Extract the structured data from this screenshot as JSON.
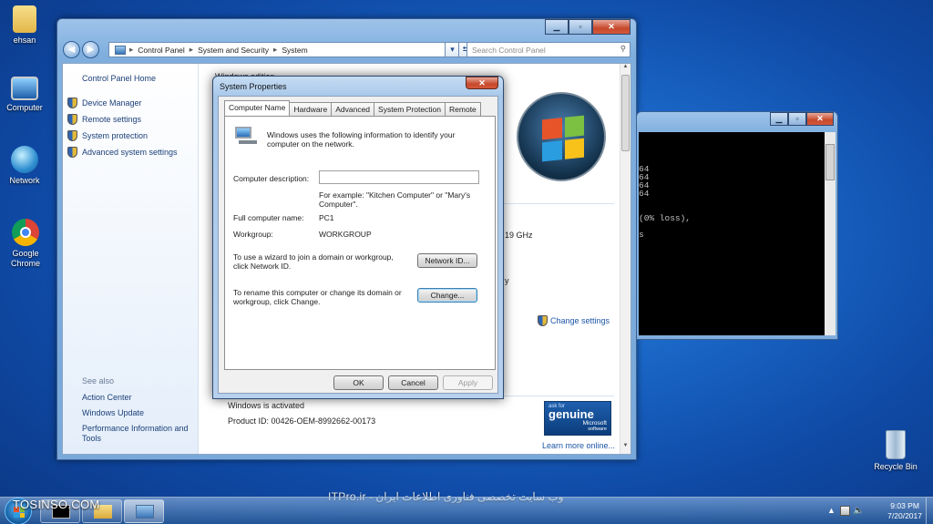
{
  "desktop": {
    "icons": [
      {
        "label": "ehsan"
      },
      {
        "label": "Computer"
      },
      {
        "label": "Network"
      },
      {
        "label": "Google Chrome"
      },
      {
        "label": "Recycle Bin"
      }
    ]
  },
  "control_panel": {
    "breadcrumb": [
      "Control Panel",
      "System and Security",
      "System"
    ],
    "search_placeholder": "Search Control Panel",
    "left": {
      "home": "Control Panel Home",
      "tasks": [
        "Device Manager",
        "Remote settings",
        "System protection",
        "Advanced system settings"
      ],
      "see_also": "See also",
      "see_also_links": [
        "Action Center",
        "Windows Update",
        "Performance Information and Tools"
      ]
    },
    "main": {
      "edition_partial": "Windows edition",
      "ghz_partial": "19 GHz",
      "y_partial": "y",
      "change_settings": "Change settings",
      "activated": "Windows is activated",
      "product_id": "Product ID: 00426-OEM-8992662-00173",
      "genuine": {
        "ask": "ask for",
        "word": "genuine",
        "brand": "Microsoft",
        "software": "software"
      },
      "learn_more": "Learn more online..."
    }
  },
  "cmd": {
    "lines": [
      "64",
      "64",
      "64",
      "64",
      "",
      "",
      "(0% loss),",
      "",
      "s"
    ]
  },
  "dialog": {
    "title": "System Properties",
    "tabs": [
      "Computer Name",
      "Hardware",
      "Advanced",
      "System Protection",
      "Remote"
    ],
    "intro": "Windows uses the following information to identify your computer on the network.",
    "desc_label": "Computer description:",
    "desc_value": "",
    "example": "For example: \"Kitchen Computer\" or \"Mary's Computer\".",
    "full_name_label": "Full computer name:",
    "full_name_value": "PC1",
    "workgroup_label": "Workgroup:",
    "workgroup_value": "WORKGROUP",
    "wizard_text": "To use a wizard to join a domain or workgroup, click Network ID.",
    "network_id_btn": "Network ID...",
    "rename_text": "To rename this computer or change its domain or workgroup, click Change.",
    "change_btn": "Change...",
    "ok_btn": "OK",
    "cancel_btn": "Cancel",
    "apply_btn": "Apply"
  },
  "watermark": {
    "site": "TOSINSO.COM",
    "farsi": "وب سایت تخصصی فناوری اطلاعات ایران - ITPro.ir"
  },
  "taskbar": {
    "time": "9:03 PM",
    "date": "7/20/2017"
  }
}
